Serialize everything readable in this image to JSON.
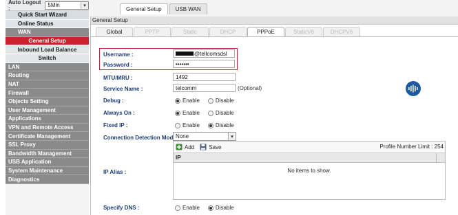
{
  "sidebar": {
    "auto_logout_label": "Auto Logout :",
    "auto_logout_value": "5Min",
    "items": [
      {
        "label": "Quick Start Wizard",
        "style": "top"
      },
      {
        "label": "Online Status",
        "style": "light"
      },
      {
        "label": "WAN",
        "style": "head"
      },
      {
        "label": "General Setup",
        "style": "sub-active"
      },
      {
        "label": "Inbound Load Balance",
        "style": "sub"
      },
      {
        "label": "Switch",
        "style": "sub"
      },
      {
        "label": "LAN",
        "style": "dark"
      },
      {
        "label": "Routing",
        "style": "dark"
      },
      {
        "label": "NAT",
        "style": "dark"
      },
      {
        "label": "Firewall",
        "style": "dark"
      },
      {
        "label": "Objects Setting",
        "style": "dark"
      },
      {
        "label": "User Management",
        "style": "dark"
      },
      {
        "label": "Applications",
        "style": "dark"
      },
      {
        "label": "VPN and Remote Access",
        "style": "dark"
      },
      {
        "label": "Certificate Management",
        "style": "dark"
      },
      {
        "label": "SSL Proxy",
        "style": "dark"
      },
      {
        "label": "Bandwidth Management",
        "style": "dark"
      },
      {
        "label": "USB Application",
        "style": "dark"
      },
      {
        "label": "System Maintenance",
        "style": "dark"
      },
      {
        "label": "Diagnostics",
        "style": "dark"
      }
    ]
  },
  "top_tabs": {
    "general": "General Setup",
    "usb": "USB WAN"
  },
  "panel": {
    "title": "General Setup",
    "tabs": [
      "Global",
      "PPTP",
      "Static",
      "DHCP",
      "PPPoE",
      "StaticV6",
      "DHCPV6"
    ],
    "active_tab": "PPPoE"
  },
  "form": {
    "username_label": "Username :",
    "username_value": "@tellcomsdsl",
    "password_label": "Password :",
    "password_value": "•••••••",
    "mtu_label": "MTU/MRU :",
    "mtu_value": "1492",
    "service_label": "Service Name :",
    "service_value": "telcomm",
    "service_hint": "(Optional)",
    "debug_label": "Debug :",
    "always_on_label": "Always On :",
    "fixed_ip_label": "Fixed IP :",
    "detect_label": "Connection Detection Mode :",
    "detect_value": "None",
    "ip_alias_label": "IP Alias :",
    "specify_dns_label": "Specify DNS :",
    "enable": "Enable",
    "disable": "Disable"
  },
  "alias_table": {
    "add": "Add",
    "save": "Save",
    "limit_label": "Profile Number Limit :",
    "limit_value": "254",
    "column": "IP",
    "empty": "No items to show."
  },
  "colors": {
    "active_menu": "#c8222a",
    "highlight": "#c3283a",
    "label_blue": "#1a3b78",
    "badge": "#1f5a9f"
  }
}
